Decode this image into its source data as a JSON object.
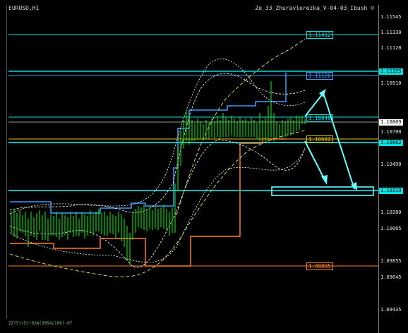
{
  "window": {
    "symbol": "EURUSD,H1",
    "indicator": "Ze_33_Zhuravlerezka_V-04-03_Ibush ☺",
    "footer": "ZZ(5)(5)(934(3954/100)-07"
  },
  "price_axis": {
    "ticks": [
      "1.11545",
      "1.11330",
      "1.11120",
      "1.10910",
      "1.10700",
      "1.10490",
      "1.10280",
      "1.10065",
      "1.09855",
      "1.09645",
      "1.09435"
    ],
    "tags": [
      {
        "label": "1.11155",
        "color": "#00e0e0"
      },
      {
        "label": "1.10809",
        "color": "#ffffff"
      },
      {
        "label": "1.10662",
        "color": "#00e0e0"
      },
      {
        "label": "1.10319",
        "color": "#00e0e0"
      }
    ]
  },
  "levels": [
    {
      "label": "1.11412",
      "color": "#00e0e0"
    },
    {
      "label": "1.11126",
      "color": "#40a0ff"
    },
    {
      "label": "1.10840",
      "color": "#00e0e0"
    },
    {
      "label": "1.10692",
      "color": "#e0c000"
    },
    {
      "label": "1.09805",
      "color": "#ff8020"
    }
  ],
  "colors": {
    "candles": "#00ff00",
    "bollinger": "#ffffff",
    "envelope": "#e8e860",
    "channel_upper": "#3aa0ff",
    "channel_lower": "#ff7a20",
    "level_line": "#00e0e0",
    "forecast": "#66ffff"
  }
}
